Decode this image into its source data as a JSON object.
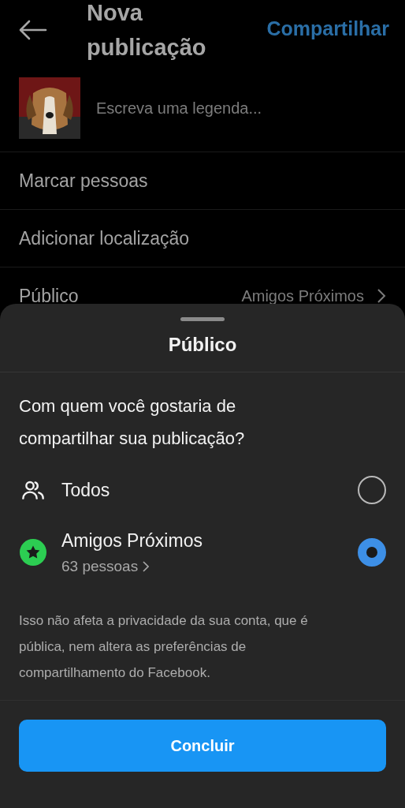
{
  "header": {
    "title": "Nova publicação",
    "action": "Compartilhar"
  },
  "caption": {
    "placeholder": "Escreva uma legenda..."
  },
  "options": [
    {
      "label": "Marcar pessoas"
    },
    {
      "label": "Adicionar localização"
    },
    {
      "label": "Público",
      "value": "Amigos Próximos"
    }
  ],
  "sheet": {
    "title": "Público",
    "question": "Com quem você gostaria de compartilhar sua publicação?",
    "choices": [
      {
        "kind": "everyone",
        "label": "Todos",
        "selected": false
      },
      {
        "kind": "close-friends",
        "label": "Amigos Próximos",
        "sublabel": "63 pessoas",
        "selected": true
      }
    ],
    "note": "Isso não afeta a privacidade da sua conta, que é pública, nem altera as preferências de compartilhamento do Facebook.",
    "button": "Concluir"
  }
}
